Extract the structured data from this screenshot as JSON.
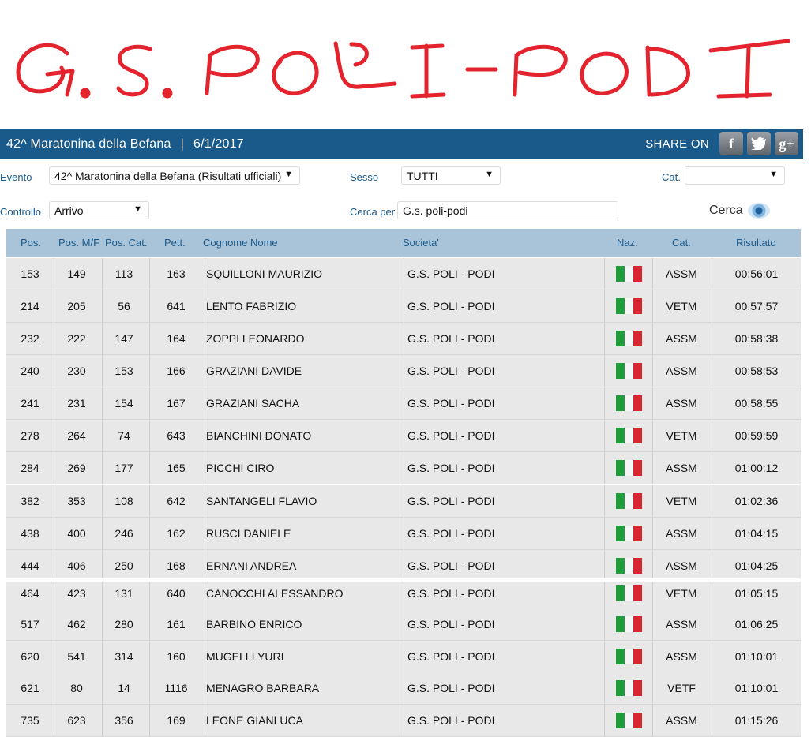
{
  "logo": {
    "text": "G.S. POLI-PODI",
    "color": "#e3232d"
  },
  "header": {
    "event_title": "42^ Maratonina della Befana",
    "separator": "|",
    "event_date": "6/1/2017",
    "share_label": "SHARE ON",
    "social": {
      "facebook": "f",
      "twitter": "t",
      "googleplus": "g+"
    },
    "bar_color": "#1a5a8a"
  },
  "filters": {
    "evento_label": "Evento",
    "evento_value": "42^ Maratonina della Befana (Risultati ufficiali)",
    "sesso_label": "Sesso",
    "sesso_value": "TUTTI",
    "cat_label": "Cat.",
    "cat_value": "",
    "controllo_label": "Controllo",
    "controllo_value": "Arrivo",
    "cerca_per_label": "Cerca per",
    "cerca_per_value": "G.s. poli-podi",
    "cerca_button": "Cerca"
  },
  "table": {
    "headers": [
      "Pos.",
      "Pos. M/F",
      "Pos. Cat.",
      "Pett.",
      "Cognome Nome",
      "Societa'",
      "Naz.",
      "Cat.",
      "Risultato"
    ],
    "rows": [
      [
        "153",
        "149",
        "113",
        "163",
        "SQUILLONI MAURIZIO",
        "G.S. POLI - PODI",
        "ITA",
        "ASSM",
        "00:56:01"
      ],
      [
        "214",
        "205",
        "56",
        "641",
        "LENTO FABRIZIO",
        "G.S. POLI - PODI",
        "ITA",
        "VETM",
        "00:57:57"
      ],
      [
        "232",
        "222",
        "147",
        "164",
        "ZOPPI LEONARDO",
        "G.S. POLI - PODI",
        "ITA",
        "ASSM",
        "00:58:38"
      ],
      [
        "240",
        "230",
        "153",
        "166",
        "GRAZIANI DAVIDE",
        "G.S. POLI - PODI",
        "ITA",
        "ASSM",
        "00:58:53"
      ],
      [
        "241",
        "231",
        "154",
        "167",
        "GRAZIANI SACHA",
        "G.S. POLI - PODI",
        "ITA",
        "ASSM",
        "00:58:55"
      ],
      [
        "278",
        "264",
        "74",
        "643",
        "BIANCHINI DONATO",
        "G.S. POLI - PODI",
        "ITA",
        "VETM",
        "00:59:59"
      ],
      [
        "284",
        "269",
        "177",
        "165",
        "PICCHI CIRO",
        "G.S. POLI - PODI",
        "ITA",
        "ASSM",
        "01:00:12"
      ],
      [
        "382",
        "353",
        "108",
        "642",
        "SANTANGELI FLAVIO",
        "G.S. POLI - PODI",
        "ITA",
        "VETM",
        "01:02:36"
      ],
      [
        "438",
        "400",
        "246",
        "162",
        "RUSCI DANIELE",
        "G.S. POLI - PODI",
        "ITA",
        "ASSM",
        "01:04:15"
      ],
      [
        "444",
        "406",
        "250",
        "168",
        "ERNANI ANDREA",
        "G.S. POLI - PODI",
        "ITA",
        "ASSM",
        "01:04:25"
      ],
      [
        "464",
        "423",
        "131",
        "640",
        "CANOCCHI ALESSANDRO",
        "G.S. POLI - PODI",
        "ITA",
        "VETM",
        "01:05:15"
      ],
      [
        "517",
        "462",
        "280",
        "161",
        "BARBINO ENRICO",
        "G.S. POLI - PODI",
        "ITA",
        "ASSM",
        "01:06:25"
      ],
      [
        "620",
        "541",
        "314",
        "160",
        "MUGELLI YURI",
        "G.S. POLI - PODI",
        "ITA",
        "ASSM",
        "01:10:01"
      ],
      [
        "621",
        "80",
        "14",
        "1116",
        "MENAGRO BARBARA",
        "G.S. POLI - PODI",
        "ITA",
        "VETF",
        "01:10:01"
      ],
      [
        "735",
        "623",
        "356",
        "169",
        "LEONE GIANLUCA",
        "G.S. POLI - PODI",
        "ITA",
        "ASSM",
        "01:15:26"
      ]
    ]
  }
}
